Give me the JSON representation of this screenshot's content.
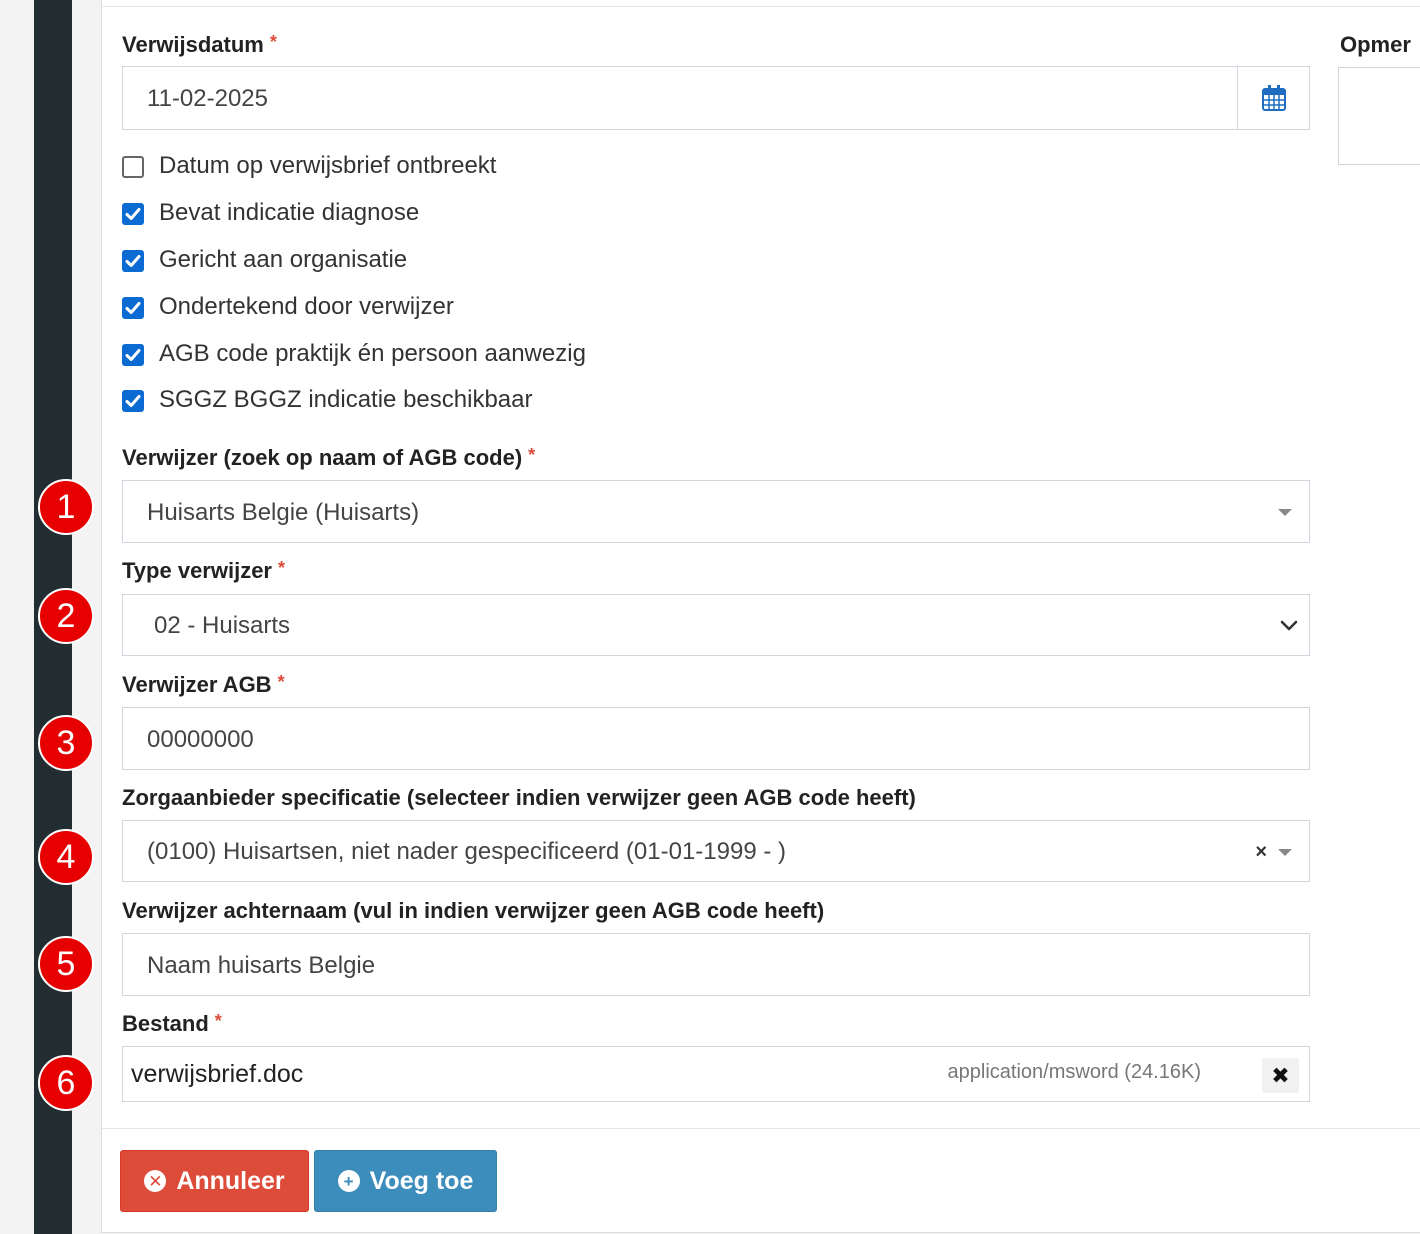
{
  "form": {
    "verwijsdatum": {
      "label": "Verwijsdatum",
      "required": "*",
      "value": "11-02-2025"
    },
    "checkboxes": [
      {
        "label": "Datum op verwijsbrief ontbreekt",
        "checked": false
      },
      {
        "label": "Bevat indicatie diagnose",
        "checked": true
      },
      {
        "label": "Gericht aan organisatie",
        "checked": true
      },
      {
        "label": "Ondertekend door verwijzer",
        "checked": true
      },
      {
        "label": "AGB code praktijk én persoon aanwezig",
        "checked": true
      },
      {
        "label": "SGGZ BGGZ indicatie beschikbaar",
        "checked": true
      }
    ],
    "verwijzer": {
      "label": "Verwijzer (zoek op naam of AGB code)",
      "required": "*",
      "value": "Huisarts Belgie (Huisarts)"
    },
    "type_verwijzer": {
      "label": "Type verwijzer",
      "required": "*",
      "value": "02 - Huisarts"
    },
    "verwijzer_agb": {
      "label": "Verwijzer AGB",
      "required": "*",
      "value": "00000000"
    },
    "zorgaanbieder": {
      "label": "Zorgaanbieder specificatie (selecteer indien verwijzer geen AGB code heeft)",
      "value": "(0100) Huisartsen, niet nader gespecificeerd (01-01-1999 - )",
      "clear": "×"
    },
    "achternaam": {
      "label": "Verwijzer achternaam (vul in indien verwijzer geen AGB code heeft)",
      "value": "Naam huisarts Belgie"
    },
    "bestand": {
      "label": "Bestand",
      "required": "*",
      "filename": "verwijsbrief.doc",
      "meta": "application/msword (24.16K)",
      "remove": "✖"
    }
  },
  "buttons": {
    "cancel": "Annuleer",
    "add": "Voeg toe"
  },
  "side": {
    "opmerking_label": "Opmer"
  },
  "badges": [
    "1",
    "2",
    "3",
    "4",
    "5",
    "6"
  ],
  "colors": {
    "danger": "#dd4b39",
    "primary": "#3c8dbc",
    "checkbox": "#0b6bd3",
    "badge": "#e60000",
    "sidebar": "#222d32"
  },
  "icons": {
    "date_picker": "calendar-icon",
    "select": "caret-down-icon",
    "native_select": "chevron-down-icon",
    "cancel": "times-circle-icon",
    "add": "plus-circle-icon"
  }
}
